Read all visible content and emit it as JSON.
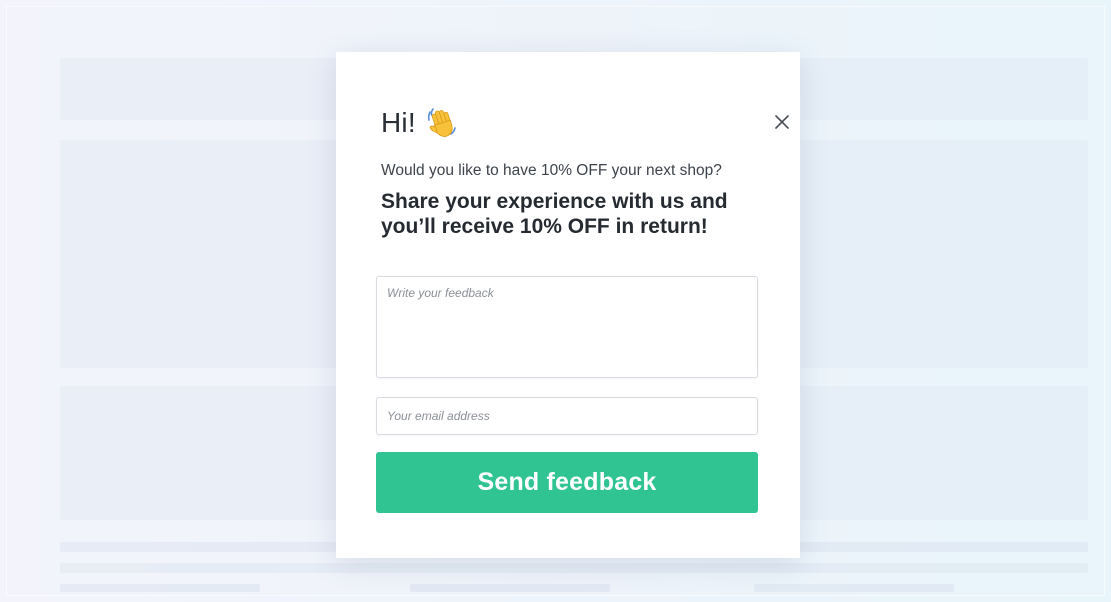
{
  "modal": {
    "greeting": "Hi!",
    "greeting_icon": "waving-hand-icon",
    "close_icon": "close-icon",
    "subtitle": "Would you like to have 10% OFF your next shop?",
    "headline": "Share your experience with us and you’ll receive 10% OFF in return!",
    "feedback_field": {
      "placeholder": "Write your feedback",
      "value": ""
    },
    "email_field": {
      "placeholder": "Your email address",
      "value": ""
    },
    "send_button_label": "Send feedback"
  },
  "colors": {
    "button": "#2fc491",
    "button_text": "#ffffff",
    "heading_text": "#262b31",
    "body_text": "#3d434a",
    "border": "#d7dbe1",
    "backdrop": "#eef3fa"
  }
}
